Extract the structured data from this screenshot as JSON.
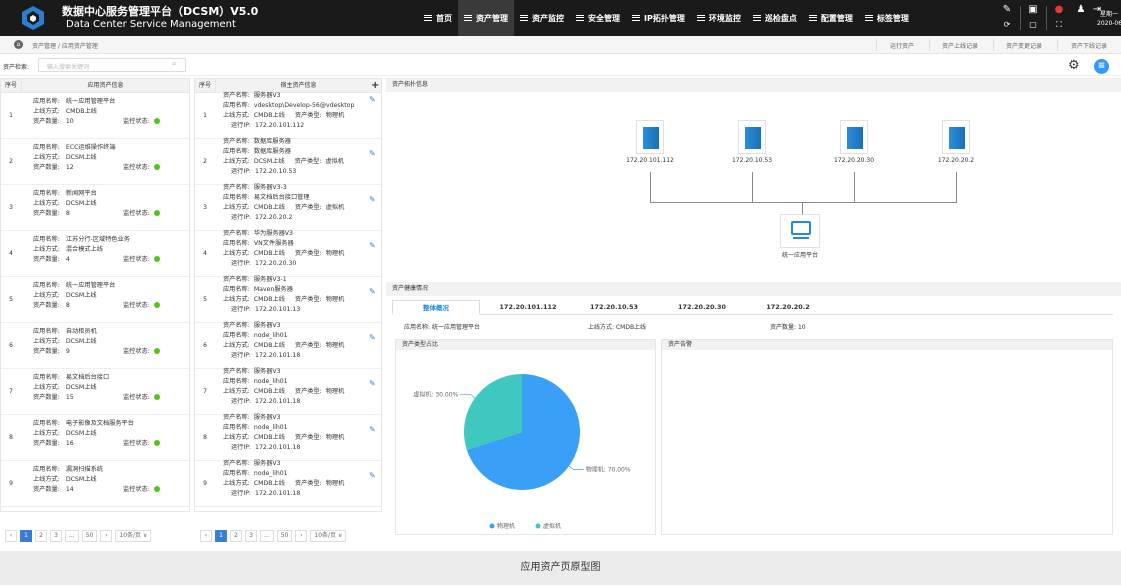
{
  "header": {
    "title_cn": "数据中心服务管理平台（DCSM）V5.0",
    "title_en": "Data Center Service Management",
    "nav": [
      {
        "label": "首页"
      },
      {
        "label": "资产管理"
      },
      {
        "label": "资产监控"
      },
      {
        "label": "安全管理"
      },
      {
        "label": "IP拓扑管理"
      },
      {
        "label": "环境监控"
      },
      {
        "label": "巡检盘点"
      },
      {
        "label": "配置管理"
      },
      {
        "label": "标签管理"
      }
    ],
    "weekday": "星期一",
    "date": "2020-06-14"
  },
  "breadcrumb": {
    "path": "资产管理 / 应用资产管理",
    "tabs": [
      "运行资产",
      "资产上线记录",
      "资产变更记录",
      "资产下线记录"
    ]
  },
  "search": {
    "label": "资产检索:",
    "placeholder": "输入搜索关键词"
  },
  "app_table": {
    "col_no": "序号",
    "col_info": "应用资产信息",
    "label_name": "应用名称:",
    "label_method": "上线方式:",
    "label_count": "资产数量:",
    "label_monitor": "监控状态:",
    "rows": [
      {
        "no": "1",
        "name": "统一应用管理平台",
        "method": "CMDB上线",
        "count": "10"
      },
      {
        "no": "2",
        "name": "ECC运维操作终端",
        "method": "DCSM上线",
        "count": "12"
      },
      {
        "no": "3",
        "name": "新闻网平台",
        "method": "DCSM上线",
        "count": "8"
      },
      {
        "no": "4",
        "name": "江苏分行-区域特色业务",
        "method": "混合模式上线",
        "count": "4"
      },
      {
        "no": "5",
        "name": "统一应用管理平台",
        "method": "DCSM上线",
        "count": "8"
      },
      {
        "no": "6",
        "name": "自动柜员机",
        "method": "DCSM上线",
        "count": "9"
      },
      {
        "no": "7",
        "name": "易文档后台接口",
        "method": "DCSM上线",
        "count": "15"
      },
      {
        "no": "8",
        "name": "电子影像及文档服务平台",
        "method": "DCSM上线",
        "count": "16"
      },
      {
        "no": "9",
        "name": "漏洞扫描系统",
        "method": "DCSM上线",
        "count": "14"
      }
    ]
  },
  "host_table": {
    "col_no": "序号",
    "col_info": "宿主资产信息",
    "add": "+",
    "label_asset": "资产名称:",
    "label_app": "应用名称:",
    "label_method": "上线方式:",
    "label_type": "资产类型:",
    "label_ip": "运行IP:",
    "rows": [
      {
        "no": "1",
        "asset": "服务器V3",
        "app": "vdesktop\\Develop-56@vdesktop",
        "method": "CMDB上线",
        "type": "物理机",
        "ip": "172.20.101.112"
      },
      {
        "no": "2",
        "asset": "数据库服务器",
        "app": "数据库服务器",
        "method": "DCSM上线",
        "type": "虚拟机",
        "ip": "172.20.10.53"
      },
      {
        "no": "3",
        "asset": "服务器V3-3",
        "app": "易文档后台接口管理",
        "method": "CMDB上线",
        "type": "虚拟机",
        "ip": "172.20.20.2"
      },
      {
        "no": "4",
        "asset": "华为服务器V3",
        "app": "VN文件服务器",
        "method": "CMDB上线",
        "type": "物理机",
        "ip": "172.20.20.30"
      },
      {
        "no": "5",
        "asset": "服务器V3-1",
        "app": "Maven服务器",
        "method": "CMDB上线",
        "type": "物理机",
        "ip": "172.20.101.13"
      },
      {
        "no": "6",
        "asset": "服务器V3",
        "app": "node_lih01",
        "method": "CMDB上线",
        "type": "物理机",
        "ip": "172.20.101.18"
      },
      {
        "no": "7",
        "asset": "服务器V3",
        "app": "node_lih01",
        "method": "CMDB上线",
        "type": "物理机",
        "ip": "172.20.101.18"
      },
      {
        "no": "8",
        "asset": "服务器V3",
        "app": "node_lih01",
        "method": "CMDB上线",
        "type": "物理机",
        "ip": "172.20.101.18"
      },
      {
        "no": "9",
        "asset": "服务器V3",
        "app": "node_lih01",
        "method": "CMDB上线",
        "type": "物理机",
        "ip": "172.20.101.18"
      }
    ]
  },
  "pager_left": {
    "pages": [
      "‹",
      "1",
      "2",
      "3",
      "...",
      "50",
      "›",
      "10条/页 ∨"
    ]
  },
  "pager_right": {
    "pages": [
      "‹",
      "1",
      "2",
      "3",
      "...",
      "50",
      "›",
      "10条/页 ∨"
    ]
  },
  "topology": {
    "title": "资产拓扑信息",
    "servers": [
      "172.20.101.112",
      "172.20.10.53",
      "172.20.20.30",
      "172.20.20.2"
    ],
    "center": "统一应用平台"
  },
  "health": {
    "title": "资产健康情况",
    "tabs": [
      "整体概况",
      "172.20.101.112",
      "172.20.10.53",
      "172.20.20.30",
      "172.20.20.2"
    ],
    "app_label": "应用名称:",
    "app_value": "统一应用管理平台",
    "method_label": "上线方式:",
    "method_value": "CMDB上线",
    "count_label": "资产数量:",
    "count_value": "10",
    "type_title": "资产类型占比",
    "alarm_title": "资产告警"
  },
  "chart_data": {
    "type": "pie",
    "categories": [
      "物理机",
      "虚拟机"
    ],
    "values": [
      70,
      30
    ],
    "labels": [
      "物理机: 70.00%",
      "虚拟机: 30.00%"
    ],
    "colors": [
      "#3aa0f5",
      "#3fc8c0"
    ],
    "legend": "bottom-center"
  },
  "caption": "应用资产页原型图"
}
